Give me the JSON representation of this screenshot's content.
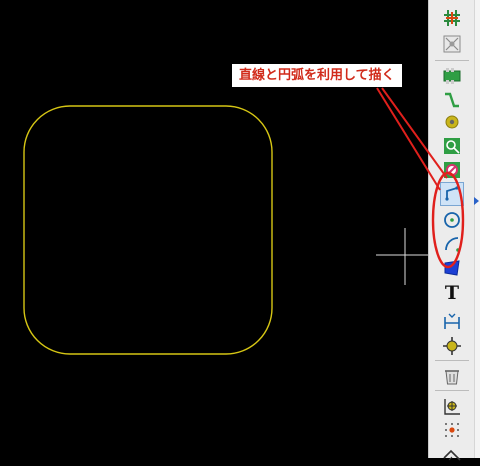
{
  "annotation": {
    "callout_text": "直線と円弧を利用して描く"
  },
  "colors": {
    "canvas_background": "#000000",
    "board_outline": "#d6c614",
    "cursor": "#dddddd",
    "annotation_red": "#e0201c"
  },
  "toolbar": {
    "tools": [
      {
        "icon": "highlight-net-icon"
      },
      {
        "icon": "local-ratsnest-icon"
      },
      {
        "icon": "add-footprint-icon"
      },
      {
        "icon": "route-track-icon"
      },
      {
        "icon": "add-via-icon"
      },
      {
        "icon": "add-zone-icon"
      },
      {
        "icon": "add-keepout-icon"
      },
      {
        "icon": "draw-line-icon",
        "active": true
      },
      {
        "icon": "draw-circle-icon"
      },
      {
        "icon": "draw-arc-icon"
      },
      {
        "icon": "draw-polygon-icon"
      },
      {
        "icon": "add-text-icon",
        "glyph": "T"
      },
      {
        "icon": "add-dimension-icon"
      },
      {
        "icon": "add-target-icon"
      },
      {
        "icon": "delete-icon"
      },
      {
        "icon": "set-origin-icon"
      },
      {
        "icon": "grid-origin-icon"
      },
      {
        "icon": "measure-icon"
      }
    ]
  }
}
